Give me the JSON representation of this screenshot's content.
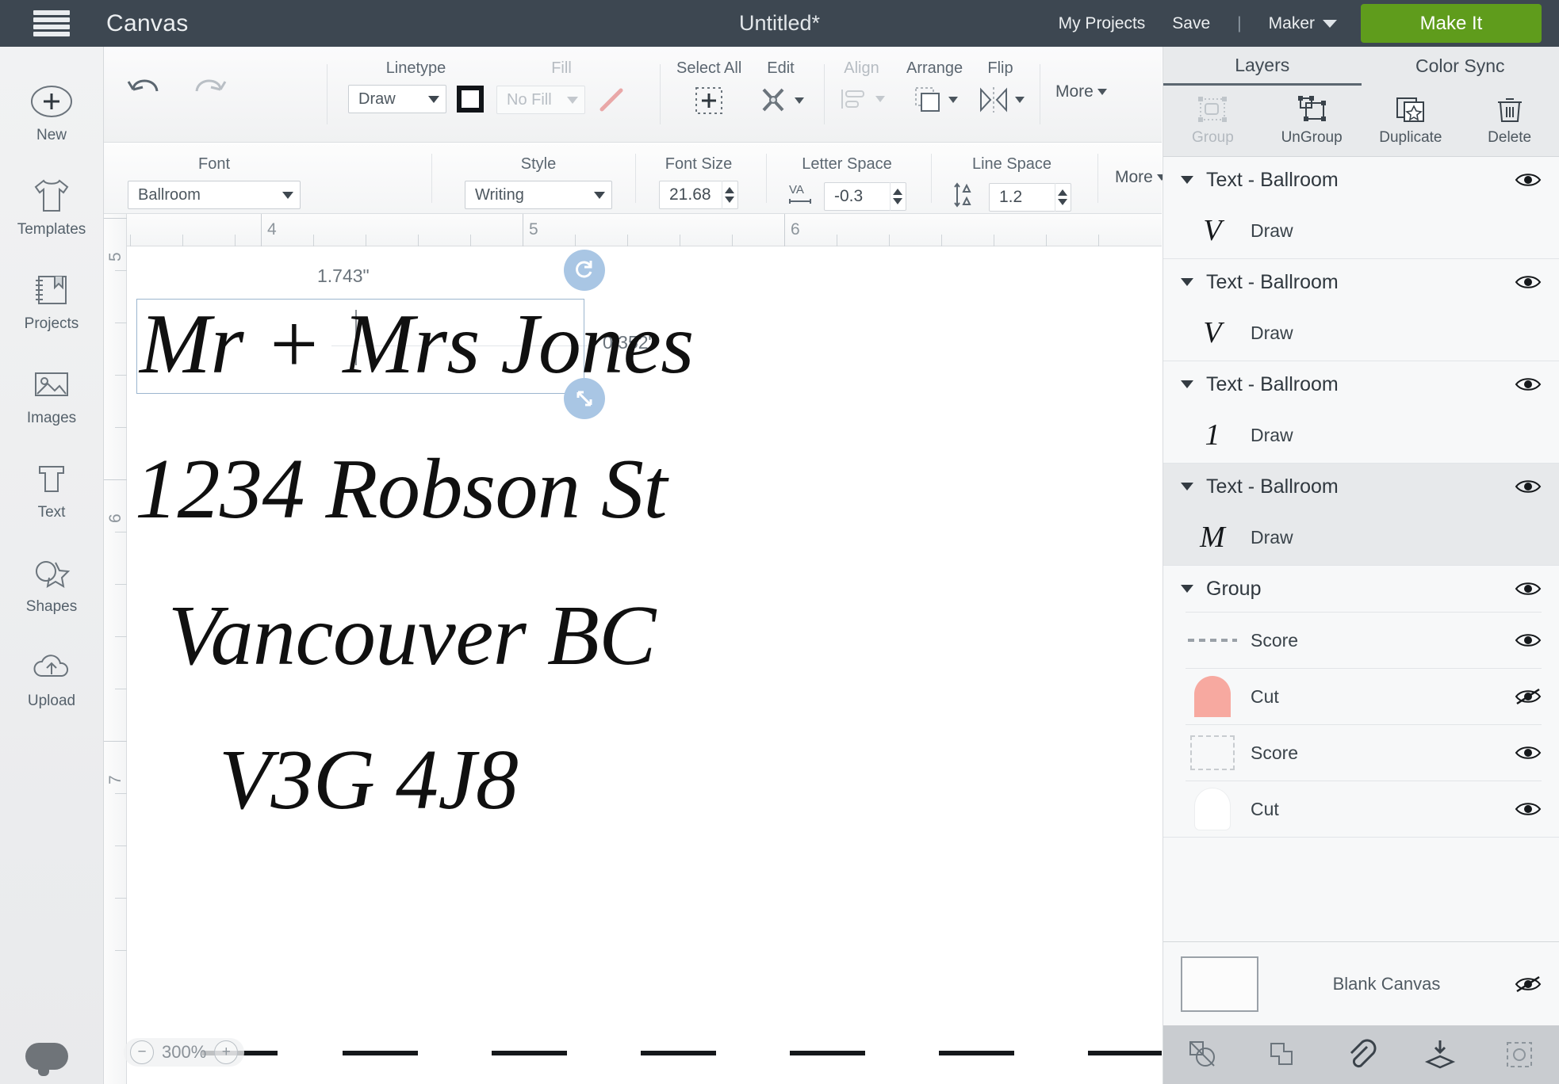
{
  "topbar": {
    "menu_icon": "hamburger-icon",
    "app_label": "Canvas",
    "document_title": "Untitled*",
    "my_projects": "My Projects",
    "save": "Save",
    "separator": "|",
    "machine": "Maker",
    "make_it": "Make It",
    "bg_color": "#3d4751",
    "make_it_color": "#5f9c1c"
  },
  "left_rail": {
    "items": [
      {
        "label": "New",
        "icon": "plus-circle-icon"
      },
      {
        "label": "Templates",
        "icon": "tshirt-icon"
      },
      {
        "label": "Projects",
        "icon": "notebook-icon"
      },
      {
        "label": "Images",
        "icon": "picture-icon"
      },
      {
        "label": "Text",
        "icon": "text-T-icon"
      },
      {
        "label": "Shapes",
        "icon": "shapes-icon"
      },
      {
        "label": "Upload",
        "icon": "cloud-upload-icon"
      }
    ],
    "chat_icon": "chat-bubble-icon"
  },
  "toolbar_row1": {
    "undo_icon": "undo-arrow-icon",
    "redo_icon": "redo-arrow-icon",
    "linetype": {
      "label": "Linetype",
      "value": "Draw",
      "swatch": "black-square-swatch"
    },
    "fill": {
      "label": "Fill",
      "value": "No Fill",
      "disabled": true,
      "pen_icon": "pink-pen-icon"
    },
    "select_all": {
      "label": "Select All",
      "icon": "select-all-icon"
    },
    "edit": {
      "label": "Edit",
      "icon": "edit-scissors-icon"
    },
    "align": {
      "label": "Align",
      "icon": "align-icon",
      "disabled": true
    },
    "arrange": {
      "label": "Arrange",
      "icon": "arrange-layers-icon"
    },
    "flip": {
      "label": "Flip",
      "icon": "flip-icon"
    },
    "more": "More"
  },
  "toolbar_row2": {
    "font": {
      "label": "Font",
      "value": "Ballroom"
    },
    "style": {
      "label": "Style",
      "value": "Writing"
    },
    "font_size": {
      "label": "Font Size",
      "value": "21.68"
    },
    "letter_space": {
      "label": "Letter Space",
      "value": "-0.3",
      "icon": "VA"
    },
    "line_space": {
      "label": "Line Space",
      "value": "1.2",
      "icon": "line-space-icon"
    },
    "more": "More"
  },
  "canvas": {
    "ruler_h_labels": [
      "4",
      "5",
      "6"
    ],
    "ruler_v_labels": [
      "5",
      "6",
      "7"
    ],
    "zoom_level": "300%",
    "zoom_out_icon": "minus-circle-icon",
    "zoom_in_icon": "plus-circle-icon",
    "selection": {
      "width_label": "1.743\"",
      "height_label": "0.352\"",
      "rotate_icon": "rotate-handle-icon",
      "resize_icon": "resize-handle-icon"
    },
    "text_lines": [
      {
        "content": "Mr + Mrs Jones",
        "selected": true
      },
      {
        "content": "1234 Robson St",
        "selected": false
      },
      {
        "content": "Vancouver BC",
        "selected": false
      },
      {
        "content": "V3G 4J8",
        "selected": false
      }
    ]
  },
  "right_panel": {
    "tabs": [
      {
        "label": "Layers",
        "active": true
      },
      {
        "label": "Color Sync",
        "active": false
      }
    ],
    "actions": [
      {
        "label": "Group",
        "icon": "group-icon",
        "disabled": true
      },
      {
        "label": "UnGroup",
        "icon": "ungroup-icon",
        "disabled": false
      },
      {
        "label": "Duplicate",
        "icon": "duplicate-icon",
        "disabled": false
      },
      {
        "label": "Delete",
        "icon": "trash-icon",
        "disabled": false
      }
    ],
    "layers": [
      {
        "name": "Text - Ballroom",
        "visible": true,
        "selected": false,
        "children": [
          {
            "glyph": "V",
            "name": "Draw",
            "thumb": "script-glyph"
          }
        ]
      },
      {
        "name": "Text - Ballroom",
        "visible": true,
        "selected": false,
        "children": [
          {
            "glyph": "V",
            "name": "Draw",
            "thumb": "script-glyph"
          }
        ]
      },
      {
        "name": "Text - Ballroom",
        "visible": true,
        "selected": false,
        "children": [
          {
            "glyph": "1",
            "name": "Draw",
            "thumb": "script-glyph"
          }
        ]
      },
      {
        "name": "Text - Ballroom",
        "visible": true,
        "selected": true,
        "children": [
          {
            "glyph": "M",
            "name": "Draw",
            "thumb": "script-glyph"
          }
        ]
      },
      {
        "name": "Group",
        "visible": true,
        "selected": false,
        "children": [
          {
            "name": "Score",
            "thumb": "score-dashes",
            "visible": true
          },
          {
            "name": "Cut",
            "thumb": "pink-cut-swatch",
            "visible": false,
            "color": "#f7a9a0"
          },
          {
            "name": "Score",
            "thumb": "score-dashed-box",
            "visible": true
          },
          {
            "name": "Cut",
            "thumb": "white-cut-swatch",
            "visible": true,
            "color": "#ffffff"
          }
        ]
      }
    ],
    "blank_canvas": {
      "label": "Blank Canvas",
      "visible": false
    },
    "bottom_icons": [
      "slice-icon",
      "weld-icon",
      "attach-icon",
      "flatten-icon",
      "contour-icon"
    ]
  }
}
